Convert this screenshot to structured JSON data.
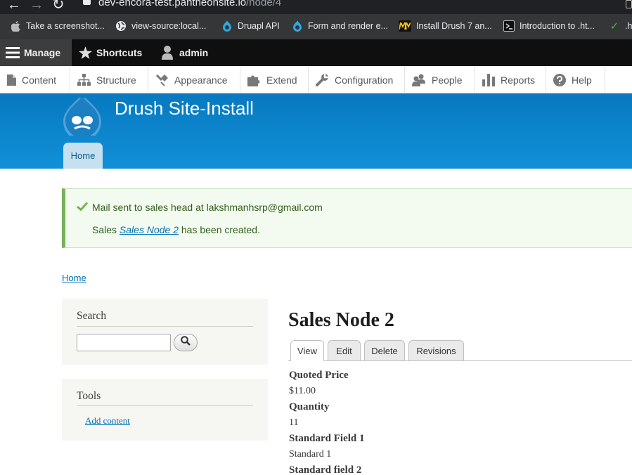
{
  "browser": {
    "url_main": "dev-encora-test.pantheonsite.io",
    "url_path": "/node/4",
    "bookmarks": [
      {
        "label": "Take a screenshot...",
        "icon": "apple-icon"
      },
      {
        "label": "view-source:local...",
        "icon": "globe-icon"
      },
      {
        "label": "Druapl API",
        "icon": "drupal-icon"
      },
      {
        "label": "Form and render e...",
        "icon": "drupal-icon"
      },
      {
        "label": "Install Drush 7 an...",
        "icon": "medium-icon"
      },
      {
        "label": "Introduction to .ht...",
        "icon": "terminal-icon"
      },
      {
        "label": ".h",
        "icon": "check-icon"
      }
    ]
  },
  "admin_toolbar": {
    "manage": "Manage",
    "shortcuts": "Shortcuts",
    "user": "admin"
  },
  "admin_tray": [
    {
      "label": "Content",
      "icon": "file-icon"
    },
    {
      "label": "Structure",
      "icon": "sitemap-icon"
    },
    {
      "label": "Appearance",
      "icon": "paintbrush-icon"
    },
    {
      "label": "Extend",
      "icon": "puzzle-icon"
    },
    {
      "label": "Configuration",
      "icon": "wrench-icon"
    },
    {
      "label": "People",
      "icon": "people-icon"
    },
    {
      "label": "Reports",
      "icon": "bar-chart-icon"
    },
    {
      "label": "Help",
      "icon": "help-icon"
    }
  ],
  "header": {
    "site_name": "Drush Site-Install",
    "home_tab": "Home"
  },
  "messages": {
    "line1": "Mail sent to sales head at lakshmanhsrp@gmail.com",
    "line2_prefix": "Sales ",
    "line2_link": "Sales Node 2",
    "line2_suffix": " has been created.",
    "status_color": "#77b259"
  },
  "breadcrumb": {
    "home": "Home"
  },
  "sidebar": {
    "search_title": "Search",
    "search_value": "",
    "tools_title": "Tools",
    "tools_link": "Add content"
  },
  "node": {
    "title": "Sales Node 2",
    "tabs": [
      "View",
      "Edit",
      "Delete",
      "Revisions"
    ],
    "active_tab": "View",
    "fields": [
      {
        "label": "Quoted Price",
        "value": "$11.00"
      },
      {
        "label": "Quantity",
        "value": "11"
      },
      {
        "label": "Standard Field 1",
        "value": "Standard 1"
      },
      {
        "label": "Standard field 2",
        "value": ""
      }
    ]
  },
  "colors": {
    "header_blue": "#0779bf",
    "link": "#0071b3"
  }
}
